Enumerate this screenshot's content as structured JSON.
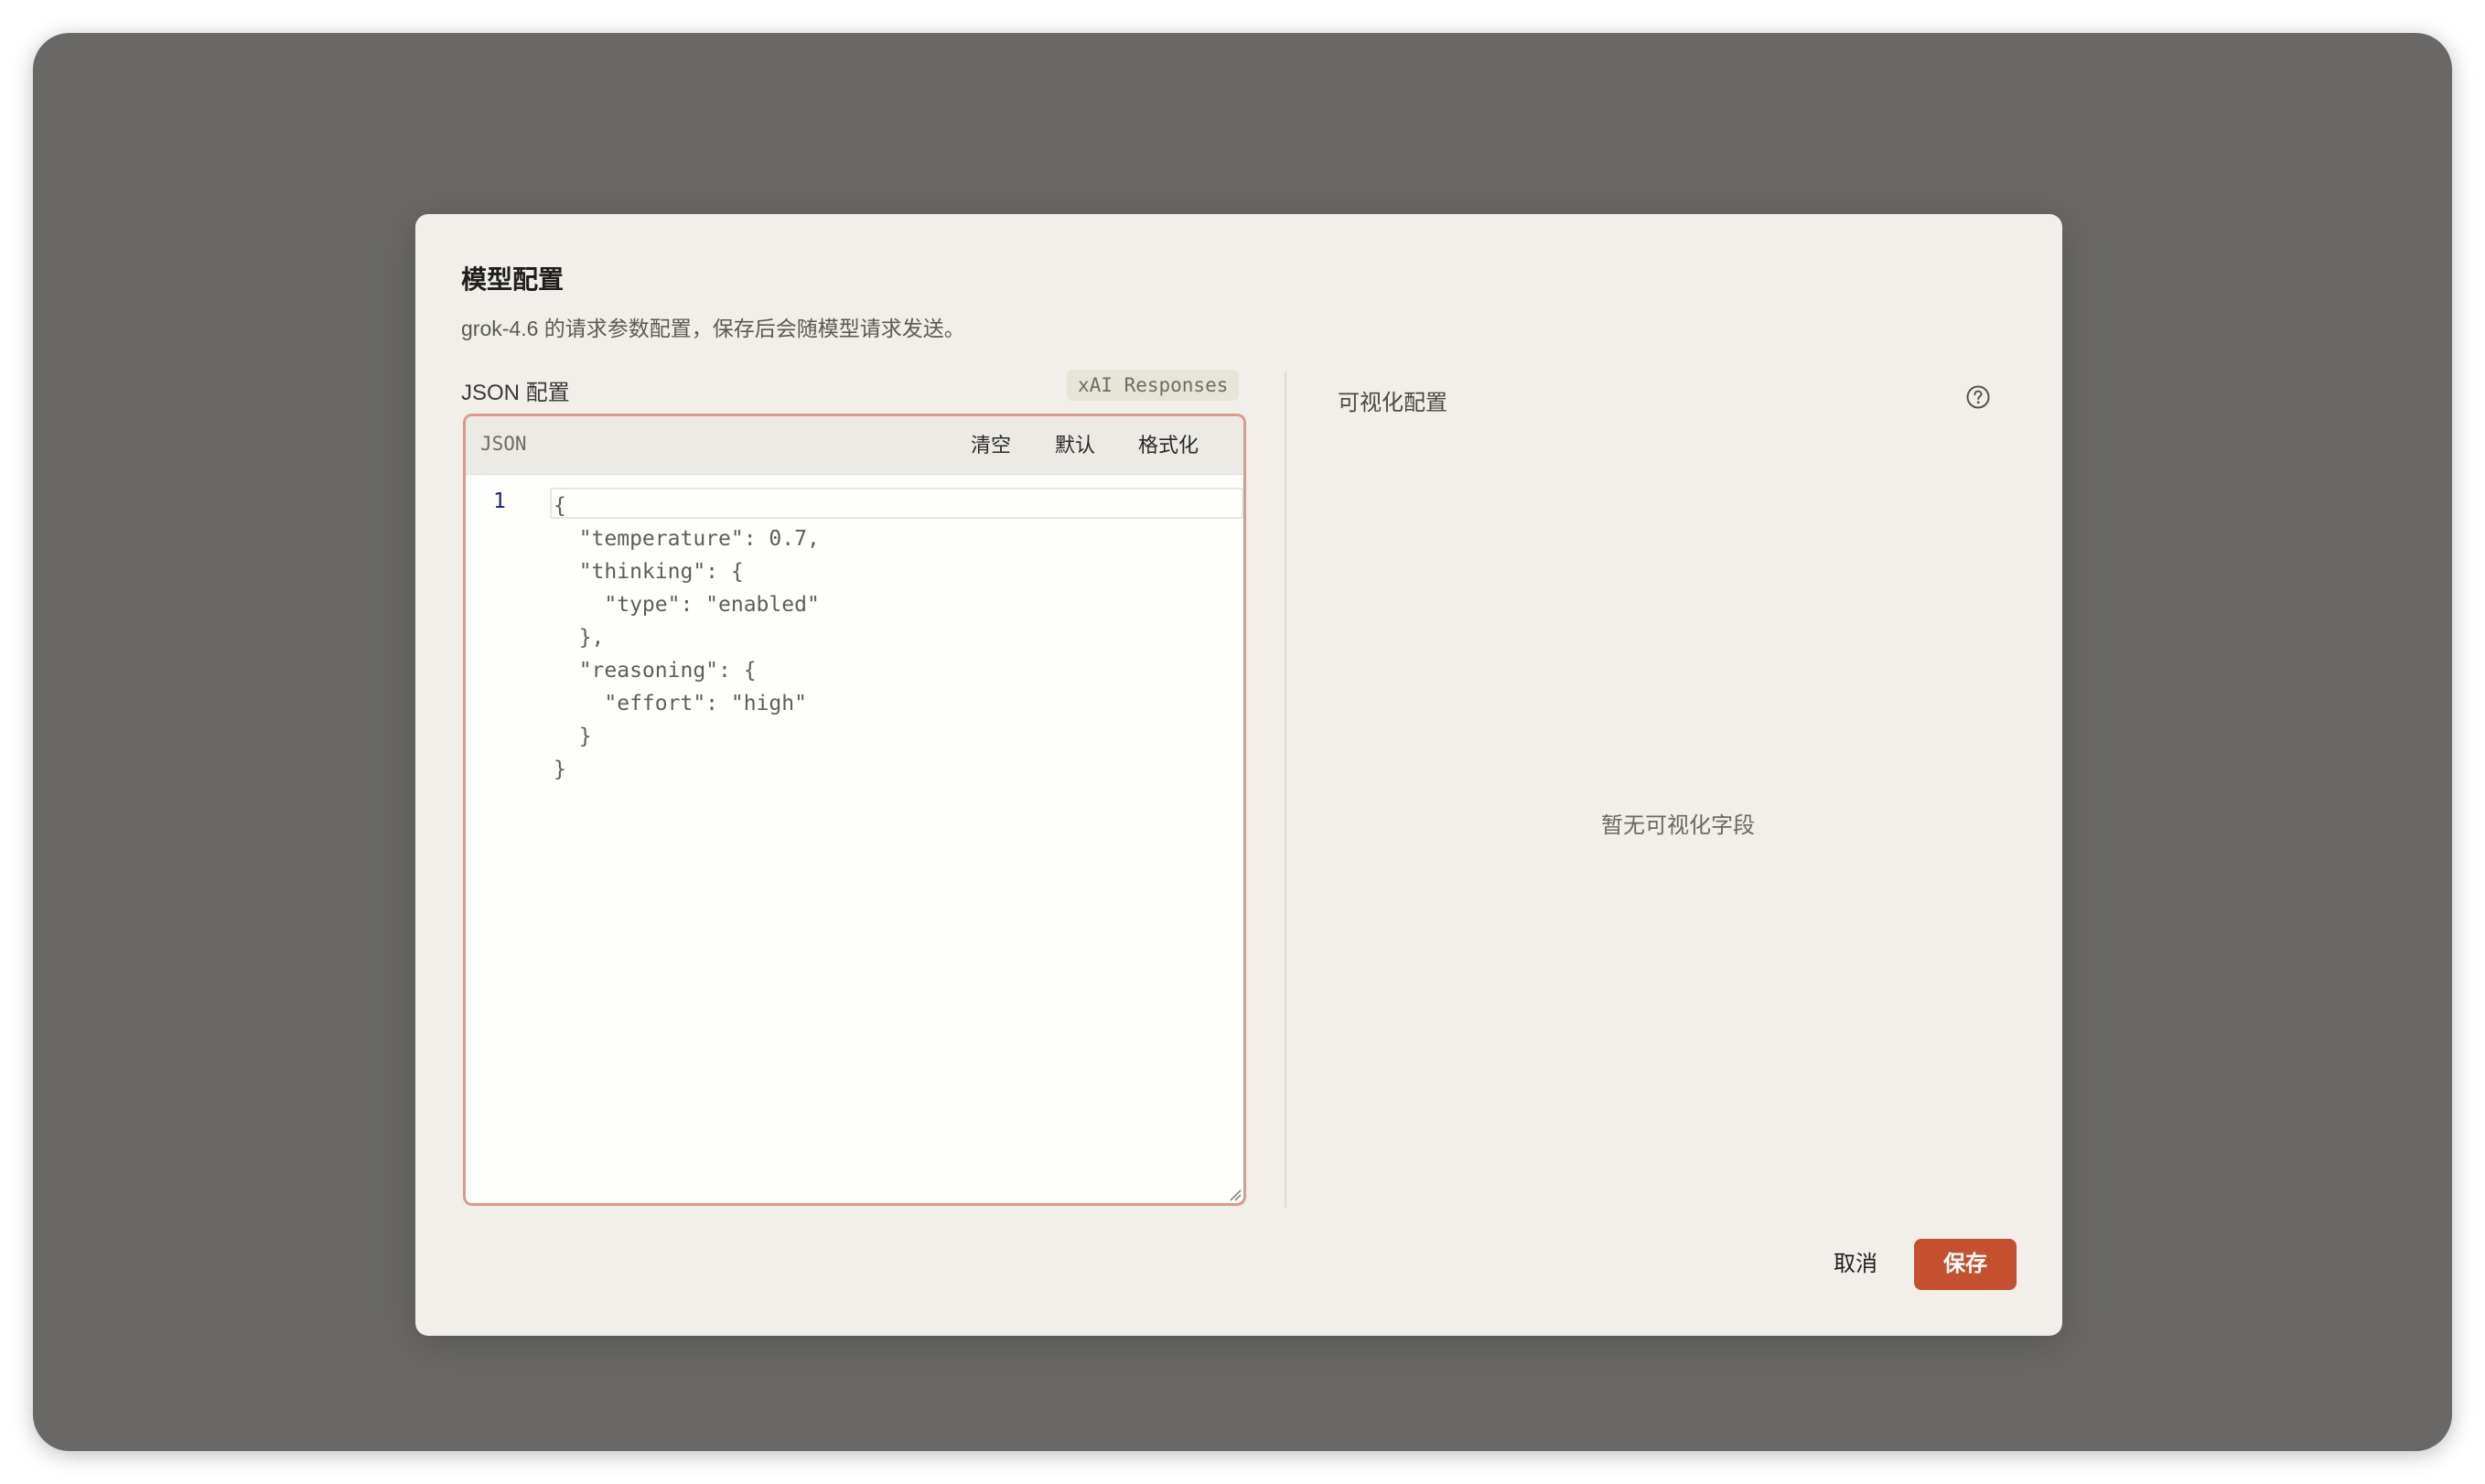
{
  "dialog": {
    "title": "模型配置",
    "subtitle": "grok-4.6 的请求参数配置，保存后会随模型请求发送。",
    "json_section_label": "JSON 配置",
    "provider_badge": "xAI Responses"
  },
  "editor": {
    "language": "JSON",
    "toolbar": {
      "clear_label": "清空",
      "default_label": "默认",
      "format_label": "格式化"
    },
    "line_number": "1",
    "content": "{\n  \"temperature\": 0.7,\n  \"thinking\": {\n    \"type\": \"enabled\"\n  },\n  \"reasoning\": {\n    \"effort\": \"high\"\n  }\n}"
  },
  "visual": {
    "label": "可视化配置",
    "empty_text": "暂无可视化字段"
  },
  "footer": {
    "cancel_label": "取消",
    "save_label": "保存"
  },
  "colors": {
    "backdrop": "#696866",
    "dialog_bg": "#f0efea",
    "editor_border": "#d99a8c",
    "primary": "#c4502f"
  },
  "icons": {
    "help": "question-circle-icon",
    "resize": "resize-grip-icon"
  }
}
